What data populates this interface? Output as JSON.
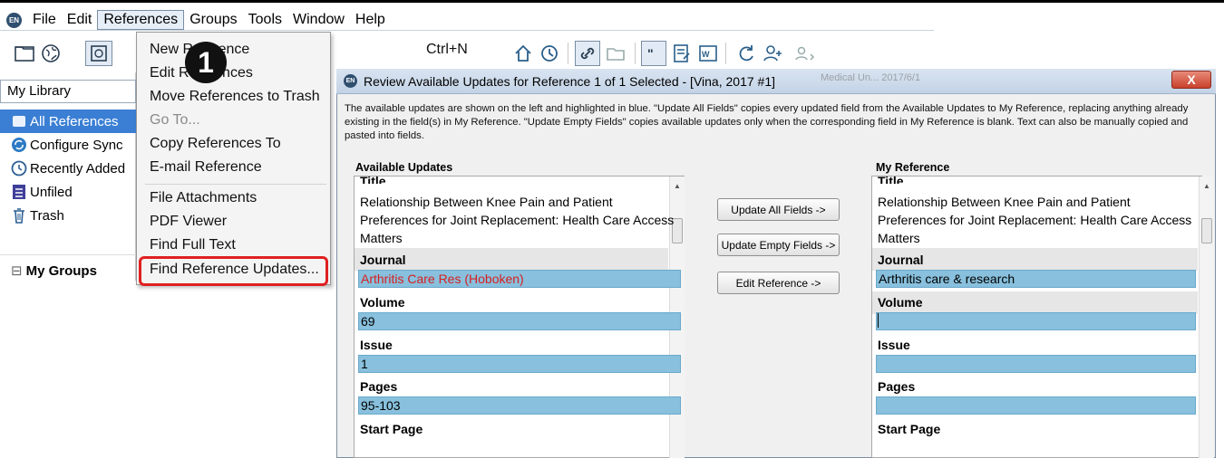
{
  "menubar": {
    "logo_text": "EN",
    "items": [
      "File",
      "Edit",
      "References",
      "Groups",
      "Tools",
      "Window",
      "Help"
    ],
    "active": "References"
  },
  "sidebar": {
    "library_select": "My Library",
    "items": [
      {
        "label": "All References",
        "icon": "references-icon",
        "selected": true
      },
      {
        "label": "Configure Sync",
        "icon": "sync-icon"
      },
      {
        "label": "Recently Added",
        "icon": "clock-icon"
      },
      {
        "label": "Unfiled",
        "icon": "unfiled-icon"
      },
      {
        "label": "Trash",
        "icon": "trash-icon"
      }
    ],
    "groups_label": "My Groups",
    "groups_expander": "⊟"
  },
  "references_menu": {
    "items": [
      {
        "label": "New Reference",
        "shortcut": "Ctrl+N"
      },
      {
        "label": "Edit References"
      },
      {
        "label": "Move References to Trash"
      },
      {
        "label": "Go To...",
        "disabled": true
      },
      {
        "label": "Copy References To"
      },
      {
        "label": "E-mail Reference"
      },
      {
        "label": "File Attachments"
      },
      {
        "label": "PDF Viewer"
      },
      {
        "label": "Find Full Text"
      },
      {
        "label": "Find Reference Updates..."
      }
    ],
    "step_badge": "1"
  },
  "toolbar": {
    "icons": [
      "folder-icon",
      "globe-icon",
      "local-library-icon",
      "home-up-icon",
      "find-fulltext-icon",
      "attach-link-icon",
      "open-folder-icon",
      "quote-icon",
      "edit-doc-icon",
      "word-icon",
      "sync-cycle-icon",
      "add-user-icon",
      "share-group-icon"
    ]
  },
  "background_text": "Medical Un...   2017/6/1",
  "dialog": {
    "title": "Review Available Updates for Reference 1 of 1 Selected - [Vina, 2017 #1]",
    "close_label": "X",
    "description": "The available updates are shown on the left and highlighted in blue. \"Update All Fields\" copies every updated field from the Available Updates to My Reference, replacing anything already existing in the field(s) in My Reference. \"Update Empty Fields\" copies available updates only when the corresponding field in My Reference is blank. Text can also be manually copied and pasted into fields.",
    "available_title": "Available Updates",
    "my_ref_title": "My Reference",
    "buttons": {
      "update_all": "Update All Fields ->",
      "update_empty": "Update Empty Fields ->",
      "edit_ref": "Edit Reference ->"
    },
    "available": {
      "title_label": "Title",
      "title_lines": [
        "Relationship Between Knee Pain and Patient",
        "Preferences for Joint Replacement: Health Care Access",
        "Matters"
      ],
      "journal_label": "Journal",
      "journal": "Arthritis Care Res (Hoboken)",
      "volume_label": "Volume",
      "volume": "69",
      "issue_label": "Issue",
      "issue": "1",
      "pages_label": "Pages",
      "pages": "95-103",
      "start_page_label": "Start Page"
    },
    "mine": {
      "title_label": "Title",
      "title_lines": [
        "Relationship Between Knee Pain and Patient",
        "Preferences for Joint Replacement: Health Care Access",
        "Matters"
      ],
      "journal_label": "Journal",
      "journal": "Arthritis care & research",
      "volume_label": "Volume",
      "volume": "",
      "issue_label": "Issue",
      "issue": "",
      "pages_label": "Pages",
      "pages": "",
      "start_page_label": "Start Page"
    }
  },
  "colors": {
    "accent": "#3b7fd4",
    "updated_field": "#88c0dd",
    "highlight": "#e02020"
  }
}
